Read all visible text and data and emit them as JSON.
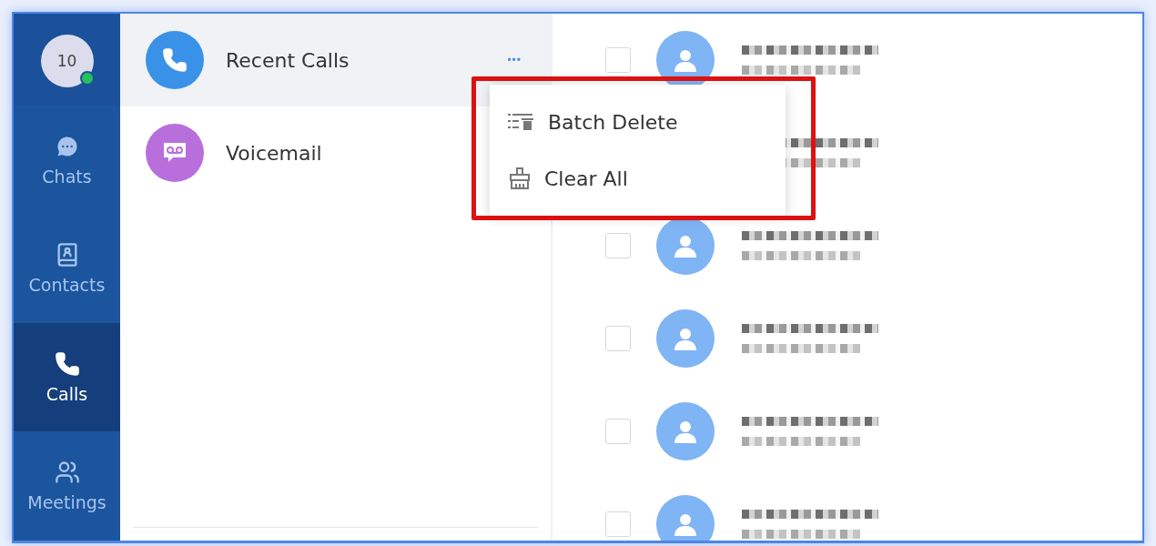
{
  "profile": {
    "avatar_text": "10",
    "online": true
  },
  "nav": [
    {
      "kind": "chats",
      "label": "Chats",
      "selected": false
    },
    {
      "kind": "contacts",
      "label": "Contacts",
      "selected": false
    },
    {
      "kind": "calls",
      "label": "Calls",
      "selected": true
    },
    {
      "kind": "meetings",
      "label": "Meetings",
      "selected": false
    }
  ],
  "call_lists": [
    {
      "kind": "recent",
      "label": "Recent Calls",
      "selected": true,
      "more_button": "•••"
    },
    {
      "kind": "voicemail",
      "label": "Voicemail",
      "selected": false
    }
  ],
  "menu": {
    "highlighted": true,
    "items": [
      {
        "kind": "batch",
        "label": "Batch Delete"
      },
      {
        "kind": "clear",
        "label": "Clear All"
      }
    ]
  },
  "calls": [
    {
      "checked": false
    },
    {
      "checked": false
    },
    {
      "checked": false
    },
    {
      "checked": false
    },
    {
      "checked": false
    }
  ]
}
